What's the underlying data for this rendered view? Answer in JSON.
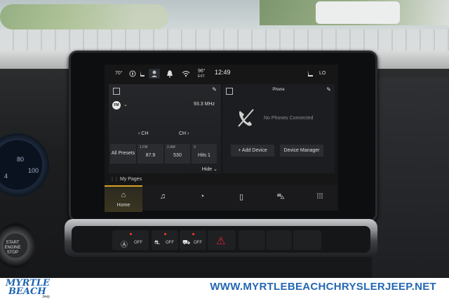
{
  "status_bar": {
    "temp_out": "70°",
    "inside_temp": "96°",
    "inside_label": "EXT",
    "clock": "12:49",
    "seat_label": "LO"
  },
  "radio": {
    "band_badge": "FM",
    "frequency": "93.3 MHz",
    "ch_prev": "CH",
    "ch_next": "CH",
    "all_presets_label": "All Presets",
    "presets": [
      {
        "num": "1.FM",
        "value": "87.9"
      },
      {
        "num": "2.AM",
        "value": "530"
      },
      {
        "num": "3",
        "value": "Hits 1"
      }
    ],
    "hide_label": "Hide"
  },
  "phone": {
    "title": "Phone",
    "status": "No Phones Connected",
    "add_device_label": "+ Add Device",
    "device_manager_label": "Device Manager"
  },
  "my_pages_label": "My Pages",
  "nav": {
    "home_label": "Home",
    "items": [
      "home-icon",
      "music-note-icon",
      "gauge-icon",
      "phone-icon",
      "car-icon",
      "apps-grid-icon"
    ]
  },
  "climate": {
    "buttons": [
      {
        "label": "OFF"
      },
      {
        "label": "OFF"
      },
      {
        "label": "OFF"
      }
    ]
  },
  "dash": {
    "cluster_labels": [
      "100",
      "80",
      "4"
    ],
    "start_label": "START ENGINE STOP"
  },
  "watermark": {
    "logo_line1": "MYRTLE",
    "logo_line2": "BEACH",
    "logo_sub": "Jeep",
    "url": "WWW.MYRTLEBEACHCHRYSLERJEEP.NET"
  },
  "colors": {
    "accent_home": "#d9a21e",
    "watermark_blue": "#2467b3",
    "hazard_red": "#e02233"
  }
}
